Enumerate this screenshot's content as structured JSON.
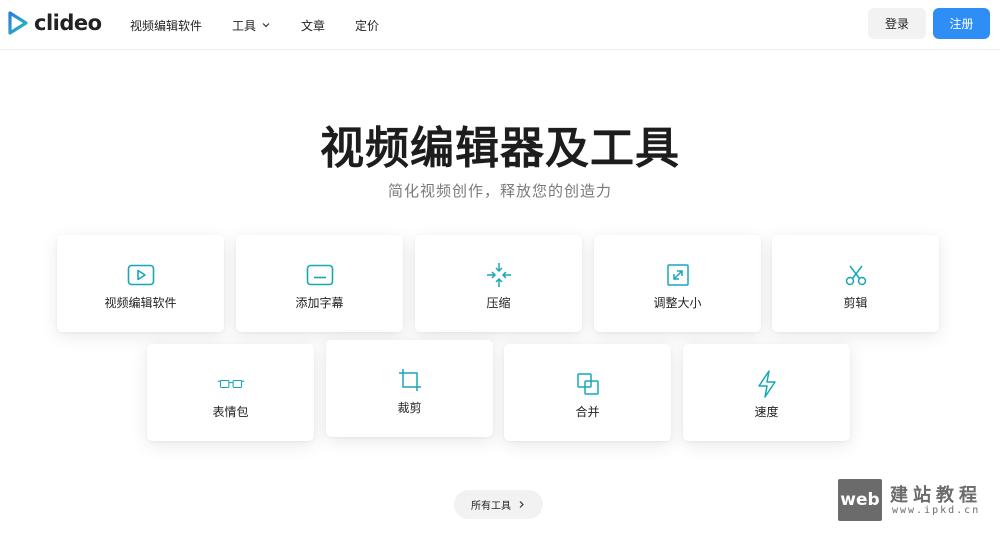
{
  "header": {
    "logo_text": "clideo",
    "nav": [
      {
        "label": "视频编辑软件"
      },
      {
        "label": "工具",
        "has_dropdown": true
      },
      {
        "label": "文章"
      },
      {
        "label": "定价"
      }
    ],
    "login_label": "登录",
    "signup_label": "注册"
  },
  "hero": {
    "title": "视频编辑器及工具",
    "subtitle": "简化视频创作，释放您的创造力"
  },
  "tools": [
    {
      "label": "视频编辑软件",
      "icon": "video-player-icon"
    },
    {
      "label": "添加字幕",
      "icon": "subtitles-icon"
    },
    {
      "label": "压缩",
      "icon": "compress-icon"
    },
    {
      "label": "调整大小",
      "icon": "resize-icon"
    },
    {
      "label": "剪辑",
      "icon": "scissors-icon"
    },
    {
      "label": "表情包",
      "icon": "glasses-icon"
    },
    {
      "label": "裁剪",
      "icon": "crop-icon"
    },
    {
      "label": "合并",
      "icon": "merge-icon"
    },
    {
      "label": "速度",
      "icon": "lightning-icon"
    }
  ],
  "all_tools_label": "所有工具",
  "watermark": {
    "box_text": "web",
    "cn_text": "建站教程",
    "url_text": "www.ipkd.cn"
  },
  "colors": {
    "accent": "#2f8ef5",
    "icon_teal": "#17a8b8",
    "logo_blue": "#2a7de1",
    "logo_teal": "#25c0b0"
  }
}
